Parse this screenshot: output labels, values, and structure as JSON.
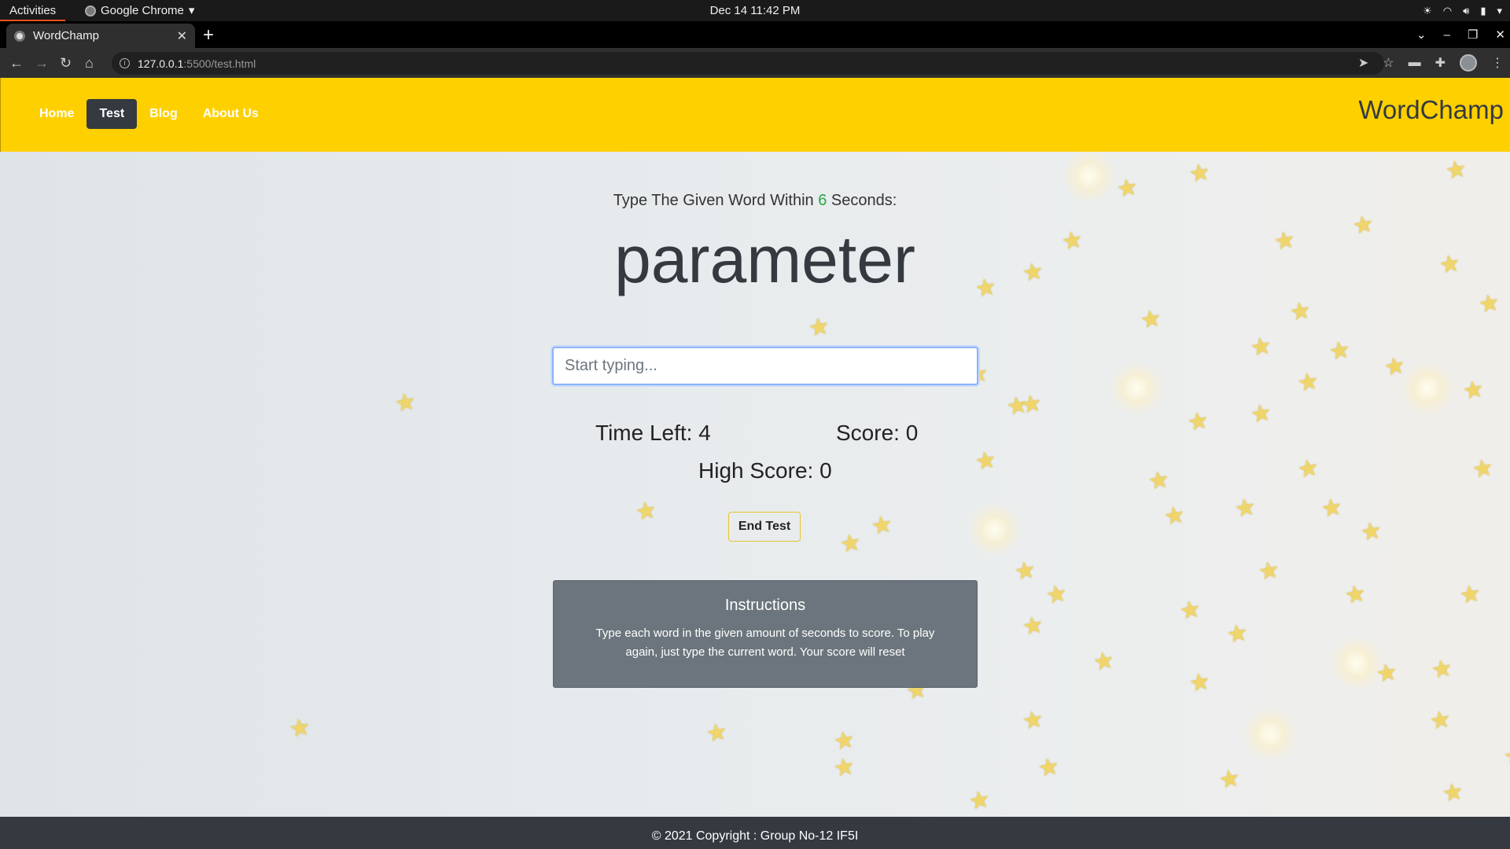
{
  "os": {
    "activities": "Activities",
    "app_name": "Google Chrome",
    "clock": "Dec 14  11:42 PM"
  },
  "browser": {
    "tab_title": "WordChamp",
    "url_host": "127.0.0.1",
    "url_rest": ":5500/test.html"
  },
  "nav": {
    "items": [
      {
        "label": "Home"
      },
      {
        "label": "Test"
      },
      {
        "label": "Blog"
      },
      {
        "label": "About Us"
      }
    ],
    "active": "Test",
    "brand": "WordChamp"
  },
  "game": {
    "prompt_before": "Type The Given Word Within ",
    "seconds": "6",
    "prompt_after": " Seconds:",
    "current_word": "parameter",
    "input_placeholder": "Start typing...",
    "input_value": "",
    "time_left_label": "Time Left: ",
    "time_left": "4",
    "score_label": "Score: ",
    "score": "0",
    "high_score_label": "High Score: ",
    "high_score": "0",
    "end_button": "End Test"
  },
  "instructions": {
    "title": "Instructions",
    "body": "Type each word in the given amount of seconds to score. To play again, just type the current word. Your score will reset"
  },
  "footer": {
    "text": "© 2021 Copyright : Group No-12 IF5I"
  },
  "colors": {
    "header_bg": "#ffd000",
    "active_nav_bg": "#343a40",
    "seconds_accent": "#28a745",
    "instructions_bg": "#6c757d",
    "footer_bg": "#343a40"
  }
}
